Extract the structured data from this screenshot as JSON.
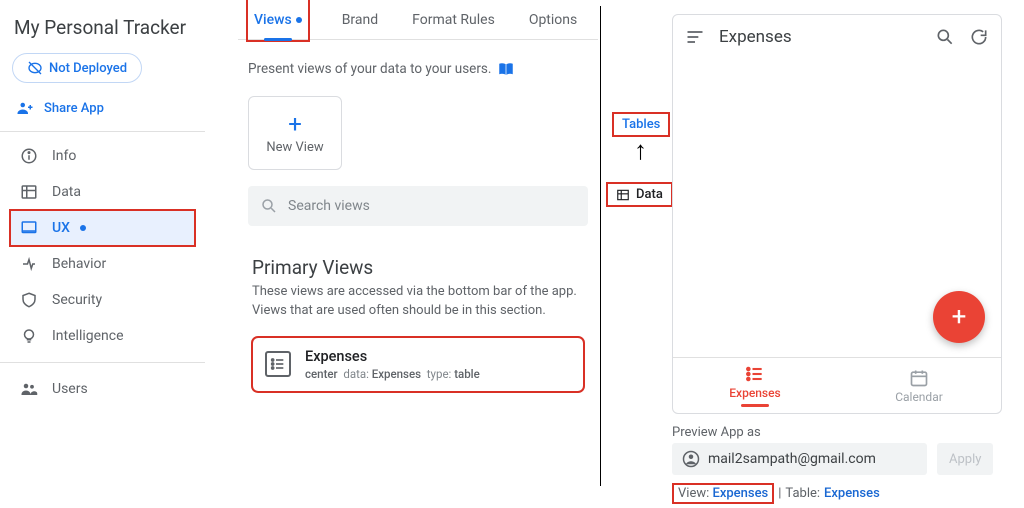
{
  "sidebar": {
    "app_title": "My Personal Tracker",
    "not_deployed": "Not Deployed",
    "share_app": "Share App",
    "items": [
      {
        "label": "Info"
      },
      {
        "label": "Data"
      },
      {
        "label": "UX"
      },
      {
        "label": "Behavior"
      },
      {
        "label": "Security"
      },
      {
        "label": "Intelligence"
      }
    ],
    "users": "Users"
  },
  "tabs": {
    "views": "Views",
    "brand": "Brand",
    "format": "Format Rules",
    "options": "Options"
  },
  "intro_text": "Present views of your data to your users.",
  "new_view_label": "New View",
  "search_placeholder": "Search views",
  "primary_views": {
    "title": "Primary Views",
    "desc": "These views are accessed via the bottom bar of the app. Views that are used often should be in this section."
  },
  "view_card": {
    "name": "Expenses",
    "pos": "center",
    "data_label": "data:",
    "data_value": "Expenses",
    "type_label": "type:",
    "type_value": "table"
  },
  "callouts": {
    "tables": "Tables",
    "data": "Data"
  },
  "phone": {
    "title": "Expenses",
    "nav_expenses": "Expenses",
    "nav_calendar": "Calendar"
  },
  "preview_as": {
    "label": "Preview App as",
    "email": "mail2sampath@gmail.com",
    "apply": "Apply",
    "view_label": "View:",
    "view_value": "Expenses",
    "table_label": "Table:",
    "table_value": "Expenses",
    "sep": "|"
  }
}
